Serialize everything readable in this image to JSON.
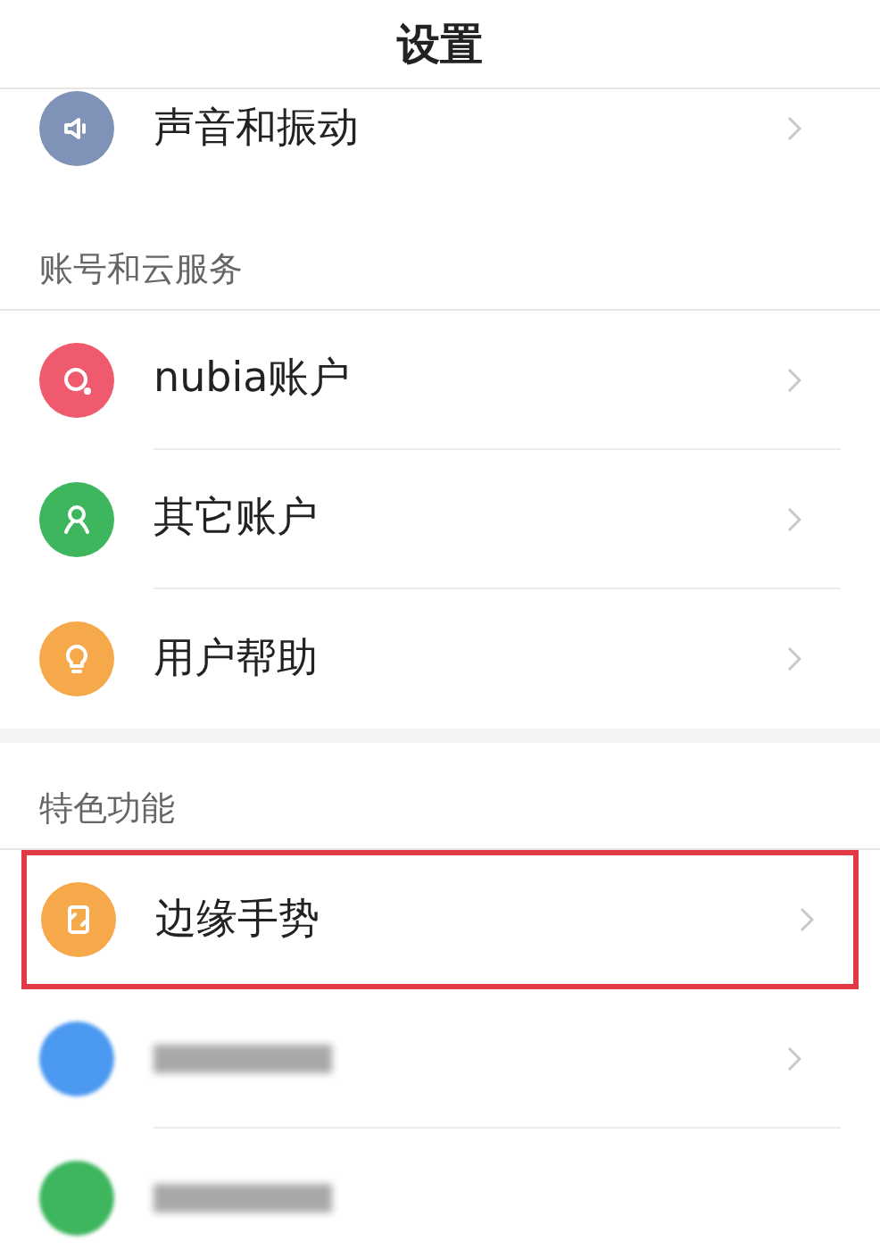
{
  "title": "设置",
  "sections": [
    {
      "items": [
        {
          "label": "声音和振动",
          "kind": "speaker",
          "color": "#7f93b8",
          "highlighted": false
        }
      ]
    },
    {
      "header": "账号和云服务",
      "items": [
        {
          "label": "nubia账户",
          "kind": "ring",
          "color": "#ef5a6e",
          "highlighted": false
        },
        {
          "label": "其它账户",
          "kind": "person",
          "color": "#3db65e",
          "highlighted": false
        },
        {
          "label": "用户帮助",
          "kind": "bulb",
          "color": "#f6a94b",
          "highlighted": false
        }
      ]
    },
    {
      "header": "特色功能",
      "items": [
        {
          "label": "边缘手势",
          "kind": "edge",
          "color": "#f6a94b",
          "highlighted": true
        },
        {
          "kind": "blurred",
          "color": "#4b98f0",
          "highlighted": false
        },
        {
          "kind": "blurred",
          "color": "#3db65e",
          "highlighted": false
        }
      ]
    }
  ]
}
